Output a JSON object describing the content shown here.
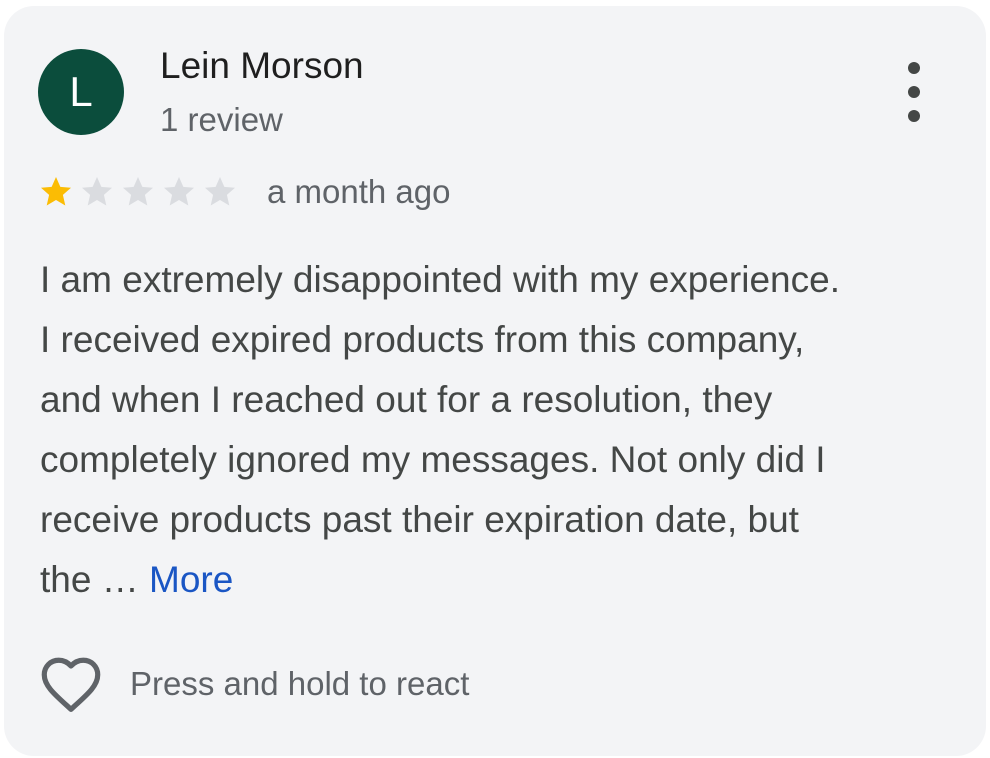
{
  "reviewer": {
    "initial": "L",
    "name": "Lein Morson",
    "review_count": "1 review",
    "avatar_color": "#0b4d3c"
  },
  "rating": {
    "value": 1,
    "max": 5,
    "filled_color": "#fbbc04",
    "empty_color": "#dadce0",
    "time": "a month ago"
  },
  "review": {
    "lines": [
      "I am extremely disappointed with my experience.",
      "I received expired products from this company,",
      "and when I reached out for a resolution, they",
      "completely ignored my messages. Not only did I",
      "receive products past their expiration date, but",
      "the …"
    ],
    "more_label": "More"
  },
  "actions": {
    "react_label": "Press and hold to react",
    "react_icon": "heart-outline-icon",
    "menu_icon": "more-vertical-icon"
  }
}
